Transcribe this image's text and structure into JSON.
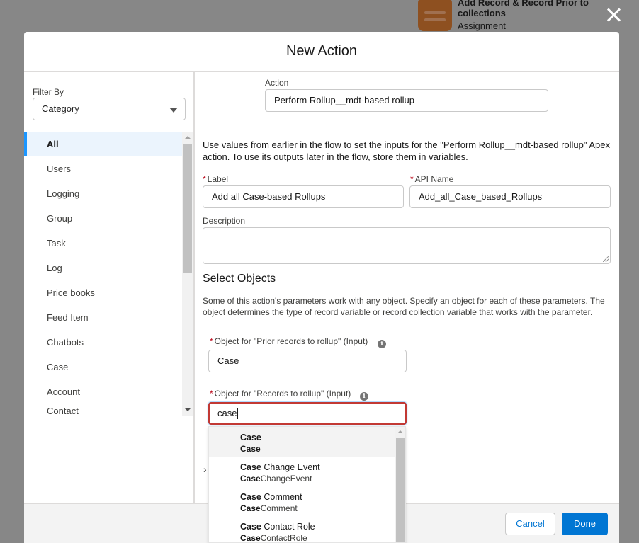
{
  "background": {
    "node_title": "Add Record & Record Prior to collections",
    "node_type": "Assignment",
    "node_icon": "assignment-icon",
    "node_color": "#8e5020"
  },
  "modal": {
    "title": "New Action",
    "close_icon": "close-icon"
  },
  "filter": {
    "label": "Filter By",
    "selected": "Category"
  },
  "categories": [
    {
      "label": "All",
      "active": true
    },
    {
      "label": "Users"
    },
    {
      "label": "Logging"
    },
    {
      "label": "Group"
    },
    {
      "label": "Task"
    },
    {
      "label": "Log"
    },
    {
      "label": "Price books"
    },
    {
      "label": "Feed Item"
    },
    {
      "label": "Chatbots"
    },
    {
      "label": "Case"
    },
    {
      "label": "Account"
    },
    {
      "label": "Contact"
    }
  ],
  "form": {
    "action_label": "Action",
    "action_value": "Perform Rollup__mdt-based rollup",
    "intro_text": "Use values from earlier in the flow to set the inputs for the \"Perform Rollup__mdt-based rollup\" Apex action. To use its outputs later in the flow, store them in variables.",
    "label_label": "Label",
    "label_value": "Add all Case-based Rollups",
    "api_name_label": "API Name",
    "api_name_value": "Add_all_Case_based_Rollups",
    "description_label": "Description",
    "description_value": "",
    "select_objects_title": "Select Objects",
    "select_objects_text": "Some of this action's parameters work with any object. Specify an object for each of these parameters. The object determines the type of record variable or record collection variable that works with the parameter.",
    "prior_records_label": "Object for \"Prior records to rollup\" (Input)",
    "prior_records_value": "Case",
    "records_label": "Object for \"Records to rollup\" (Input)",
    "records_value": "case",
    "required_marker": "*",
    "info_glyph": "i"
  },
  "dropdown": {
    "options": [
      {
        "match": "Case",
        "rest": "",
        "api_match": "Case",
        "api_rest": ""
      },
      {
        "match": "Case",
        "rest": " Change Event",
        "api_match": "Case",
        "api_rest": "ChangeEvent"
      },
      {
        "match": "Case",
        "rest": " Comment",
        "api_match": "Case",
        "api_rest": "Comment"
      },
      {
        "match": "Case",
        "rest": " Contact Role",
        "api_match": "Case",
        "api_rest": "ContactRole"
      }
    ]
  },
  "footer": {
    "cancel_label": "Cancel",
    "done_label": "Done"
  },
  "colors": {
    "brand_blue": "#0176d3",
    "error_red": "#c23934",
    "active_bar": "#1b96ff"
  }
}
